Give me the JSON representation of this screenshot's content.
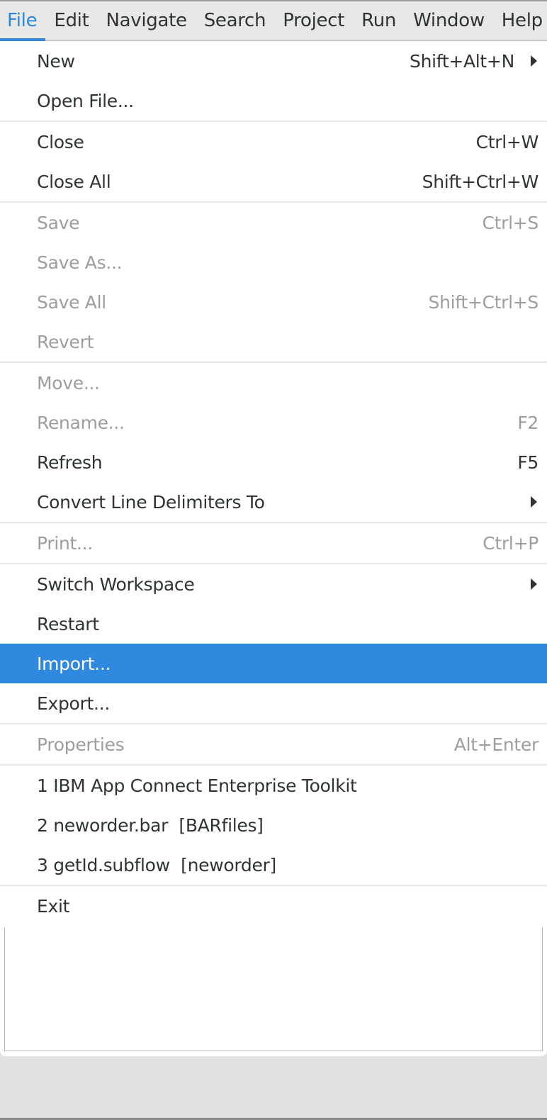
{
  "menubar": {
    "items": [
      {
        "label": "File",
        "active": true
      },
      {
        "label": "Edit"
      },
      {
        "label": "Navigate"
      },
      {
        "label": "Search"
      },
      {
        "label": "Project"
      },
      {
        "label": "Run"
      },
      {
        "label": "Window"
      },
      {
        "label": "Help"
      }
    ]
  },
  "file_menu": {
    "items": [
      {
        "label": "New",
        "accel": "Shift+Alt+N",
        "submenu": true,
        "enabled": true
      },
      {
        "label": "Open File...",
        "accel": "",
        "enabled": true
      },
      {
        "label": "Close",
        "accel": "Ctrl+W",
        "enabled": true
      },
      {
        "label": "Close All",
        "accel": "Shift+Ctrl+W",
        "enabled": true
      },
      {
        "label": "Save",
        "accel": "Ctrl+S",
        "enabled": false
      },
      {
        "label": "Save As...",
        "accel": "",
        "enabled": false
      },
      {
        "label": "Save All",
        "accel": "Shift+Ctrl+S",
        "enabled": false
      },
      {
        "label": "Revert",
        "accel": "",
        "enabled": false
      },
      {
        "label": "Move...",
        "accel": "",
        "enabled": false
      },
      {
        "label": "Rename...",
        "accel": "F2",
        "enabled": false
      },
      {
        "label": "Refresh",
        "accel": "F5",
        "enabled": true
      },
      {
        "label": "Convert Line Delimiters To",
        "accel": "",
        "submenu": true,
        "enabled": true
      },
      {
        "label": "Print...",
        "accel": "Ctrl+P",
        "enabled": false
      },
      {
        "label": "Switch Workspace",
        "accel": "",
        "submenu": true,
        "enabled": true
      },
      {
        "label": "Restart",
        "accel": "",
        "enabled": true
      },
      {
        "label": "Import...",
        "accel": "",
        "enabled": true,
        "selected": true
      },
      {
        "label": "Export...",
        "accel": "",
        "enabled": true
      },
      {
        "label": "Properties",
        "accel": "Alt+Enter",
        "enabled": false
      },
      {
        "label": "1 IBM App Connect Enterprise Toolkit",
        "accel": "",
        "enabled": true
      },
      {
        "label": "2 neworder.bar  [BARfiles]",
        "accel": "",
        "enabled": true
      },
      {
        "label": "3 getId.subflow  [neworder]",
        "accel": "",
        "enabled": true
      },
      {
        "label": "Exit",
        "accel": "",
        "enabled": true
      }
    ]
  },
  "colors": {
    "accent": "#2f86d5",
    "selection": "#2f8adf",
    "disabled_text": "#9a9e9e",
    "text": "#2e3436"
  }
}
